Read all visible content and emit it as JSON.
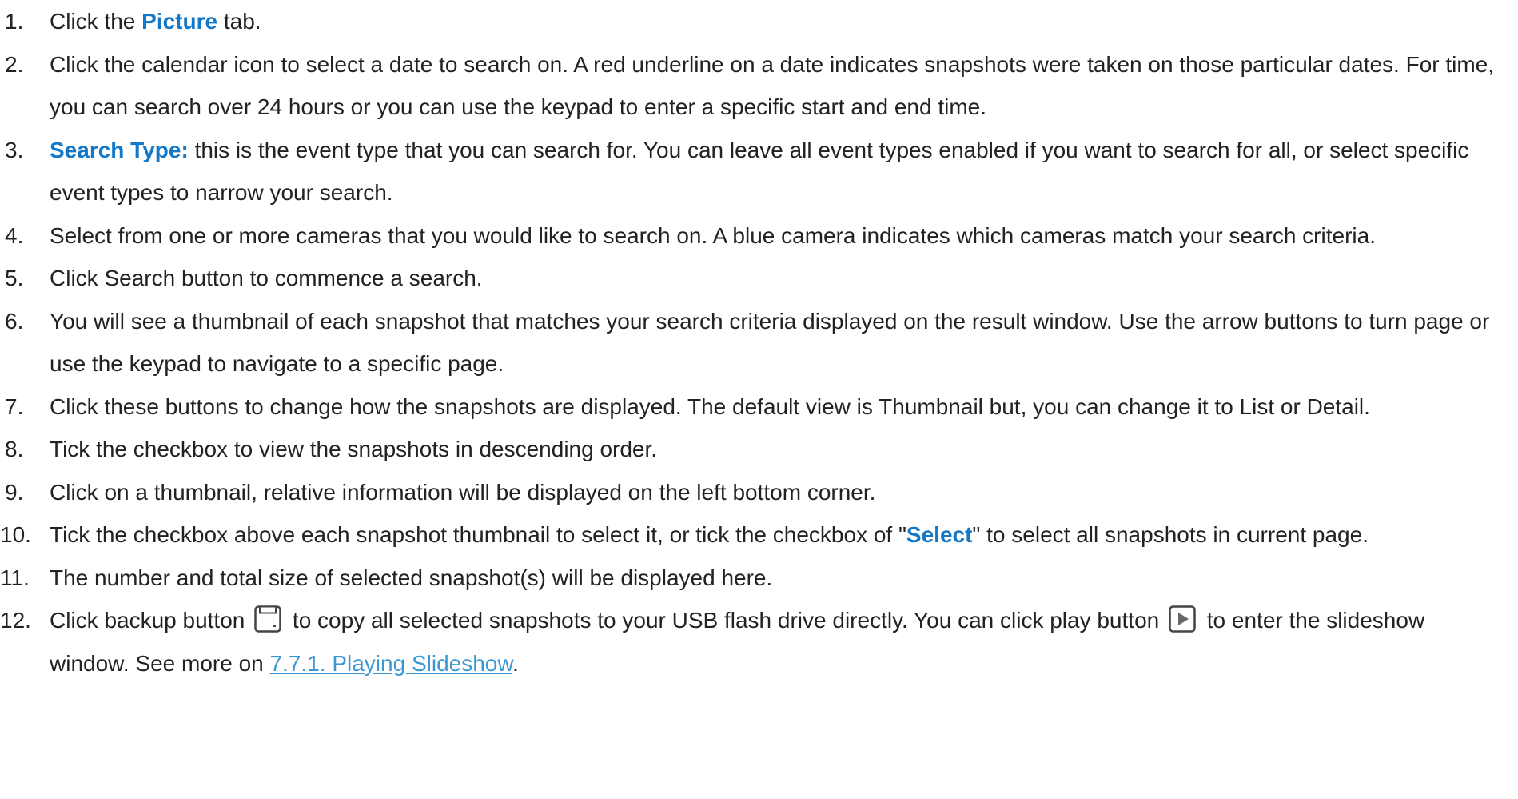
{
  "steps": [
    {
      "num": "1.",
      "a": "Click the ",
      "hl": "Picture",
      "b": " tab."
    },
    {
      "num": "2.",
      "text": "Click the calendar icon to select a date to search on. A red underline on a date indicates snapshots were taken on those particular dates. For time, you can search over 24 hours or you can use the keypad to enter a specific start and end time."
    },
    {
      "num": "3.",
      "hl": "Search Type:",
      "b": " this is the event type that you can search for. You can leave all event types enabled if you want to search for all, or select specific event types to narrow your search."
    },
    {
      "num": "4.",
      "text": "Select from one or more cameras that you would like to search on. A blue camera indicates which cameras match your search criteria."
    },
    {
      "num": "5.",
      "text": "Click Search button to commence a search."
    },
    {
      "num": "6.",
      "text": "You will see a thumbnail of each snapshot that matches your search criteria displayed on the result window. Use the arrow buttons to turn page or use the keypad to navigate to a specific page."
    },
    {
      "num": "7.",
      "text": "Click these buttons to change how the snapshots are displayed. The default view is Thumbnail but, you can change it to List or Detail."
    },
    {
      "num": "8.",
      "text": "Tick the checkbox to view the snapshots in descending order."
    },
    {
      "num": "9.",
      "text": "Click on a thumbnail, relative information will be displayed on the left bottom corner."
    },
    {
      "num": "10.",
      "a": "Tick the checkbox above each snapshot thumbnail to select it, or tick the checkbox of \"",
      "hl": "Select",
      "b": "\" to select all snapshots in current page."
    },
    {
      "num": "11.",
      "text": "The number and total size of selected snapshot(s) will be displayed here."
    },
    {
      "num": "12.",
      "a": "Click backup button ",
      "b": " to copy all selected snapshots to your USB flash drive directly. You can click play button ",
      "c": " to enter the slideshow window. See more on ",
      "link": "7.7.1. Playing Slideshow",
      "d": "."
    }
  ],
  "icons": {
    "backup": "floppy-disk-icon",
    "play": "play-icon"
  },
  "colors": {
    "highlight": "#1478c8",
    "link": "#3a97d4",
    "text": "#222222"
  }
}
